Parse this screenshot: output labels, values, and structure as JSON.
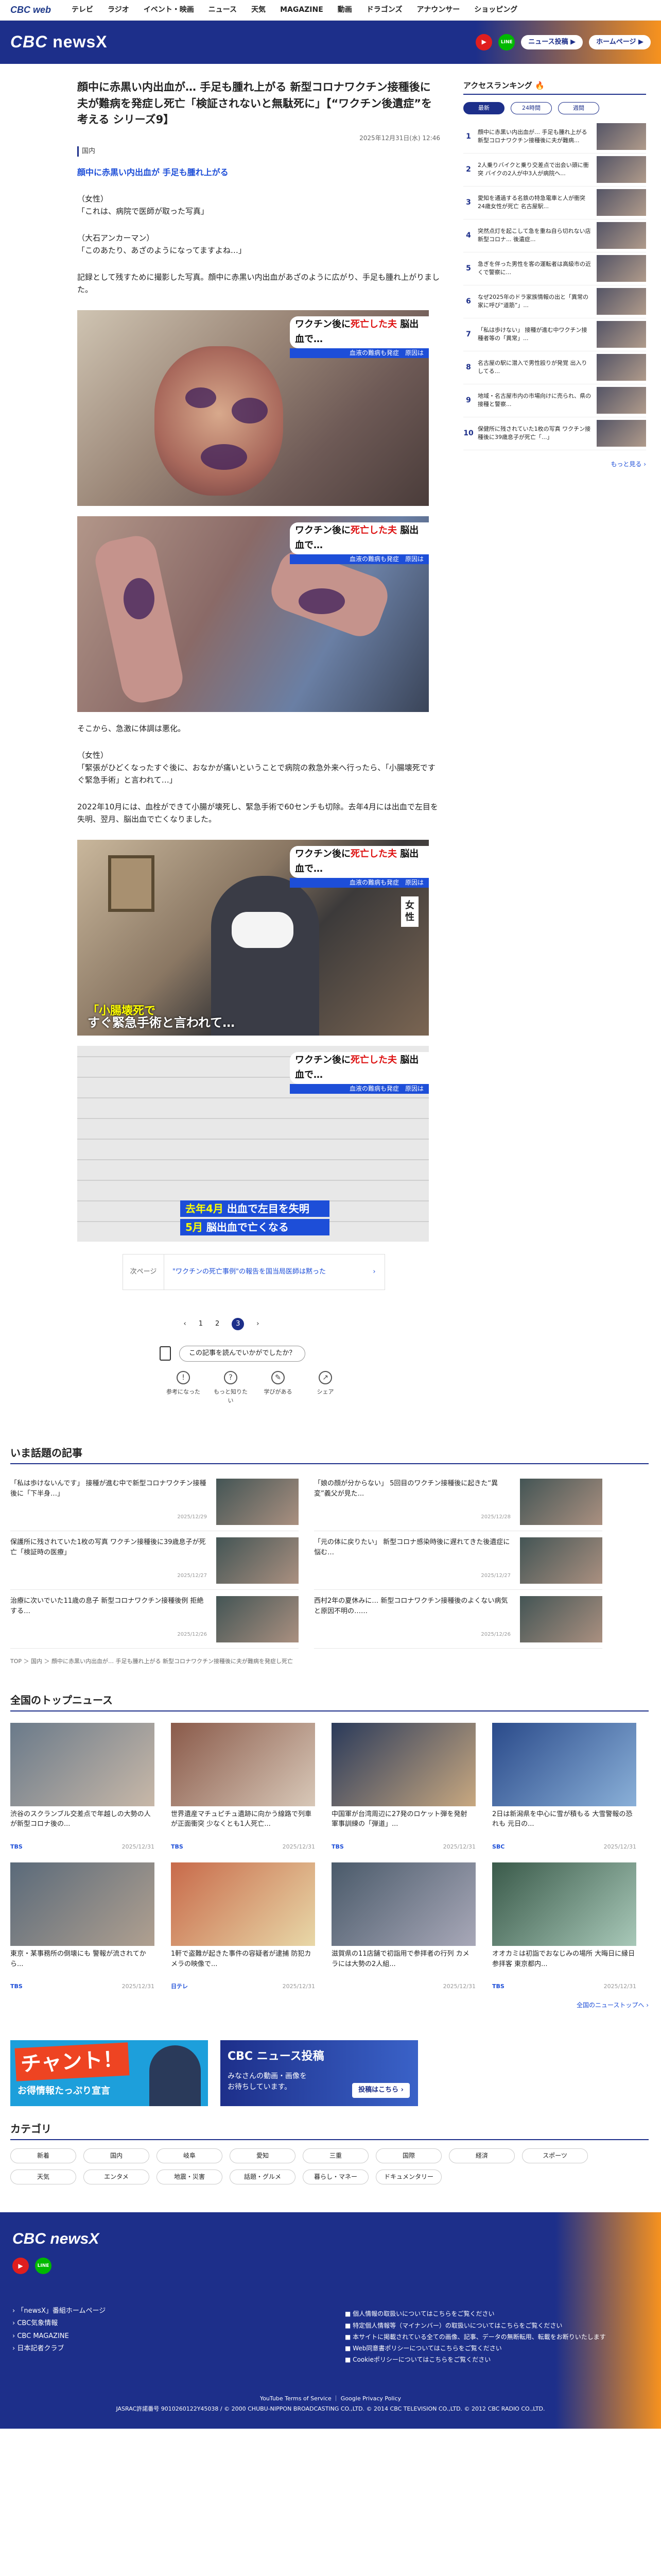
{
  "topnav": {
    "brand": "CBC web",
    "items": [
      "テレビ",
      "ラジオ",
      "イベント・映画",
      "ニュース",
      "天気",
      "MAGAZINE",
      "動画",
      "ドラゴンズ",
      "アナウンサー",
      "ショッピング"
    ]
  },
  "header": {
    "logo": "CBC",
    "logo_x": "newsX",
    "yt": "▶",
    "line": "LINE",
    "post": "ニュース投稿 ▶",
    "home": "ホームページ ▶"
  },
  "article": {
    "title": "顔中に赤黒い内出血が… 手足も腫れ上がる 新型コロナワクチン接種後に夫が難病を発症し死亡「検証されないと無駄死に」【“ワクチン後遺症”を考える シリーズ9】",
    "date": "2025年12月31日(水) 12:46",
    "category": "国内",
    "subhead": "顔中に赤黒い内出血が 手足も腫れ上がる",
    "p1": [
      "（女性）",
      "「これは、病院で医師が取った写真」"
    ],
    "p2": [
      "（大石アンカーマン）",
      "「このあたり、あざのようになってますよね…」"
    ],
    "p3": [
      "記録として残すために撮影した写真。顔中に赤黒い内出血があざのように広がり、手足も腫れ上がりました。"
    ],
    "tag1": "ワクチン後に",
    "tag1r": "死亡した夫",
    "tag1b": " 脳出血で…",
    "tag2": "血液の難病も発症　原因は",
    "p4": [
      "そこから、急激に体調は悪化。"
    ],
    "p5": [
      "（女性）",
      "「緊張がひどくなったすぐ後に、おなかが痛いということで病院の救急外来へ行ったら、「小腸壊死ですぐ緊急手術」と言われて…」"
    ],
    "p6": [
      "2022年10月には、血栓ができて小腸が壊死し、緊急手術で60センチも切除。去年4月には出血で左目を失明、翌月、脳出血で亡くなりました。"
    ],
    "cap_y": "「小腸壊死で",
    "cap_w": "すぐ緊急手術と言われて…",
    "side": "女性",
    "sub1a": "去年4月",
    "sub1b": " 出血で左目を失明",
    "sub2a": "5月",
    "sub2b": " 脳出血で亡くなる",
    "next_label": "次ページ",
    "next_text": "\"ワクチンの死亡事例\"の報告を国当局医師は黙った",
    "next_arrow": "›",
    "pages": [
      "‹",
      "1",
      "2",
      "3",
      "›"
    ],
    "react_q": "この記事を読んでいかがでしたか？",
    "reactions": [
      {
        "g": "!",
        "l": "参考になった"
      },
      {
        "g": "?",
        "l": "もっと知りたい"
      },
      {
        "g": "✎",
        "l": "学びがある"
      },
      {
        "g": "↗",
        "l": "シェア"
      }
    ]
  },
  "sidebar": {
    "title": "アクセスランキング",
    "title_icon": "🔥",
    "tabs": [
      "最新",
      "24時間",
      "週間"
    ],
    "items": [
      {
        "n": "1",
        "t": "顔中に赤黒い内出血が… 手足も腫れ上がる 新型コロナワクチン接種後に夫が難病..."
      },
      {
        "n": "2",
        "t": "2人乗りバイクと乗り交差点で出会い頭に衝突 バイクの2人が中3人が病院へ..."
      },
      {
        "n": "3",
        "t": "愛知を通過する名鉄の特急電車と人が衝突 24歳女性が死亡 名古屋駅..."
      },
      {
        "n": "4",
        "t": "突然点灯を起こして急を重ね自ら切れない店 新型コロナ... 後遺症..."
      },
      {
        "n": "5",
        "t": "急ぎを伴った男性を客の運転者は高級市の近くで警察に..."
      },
      {
        "n": "6",
        "t": "なぜ2025年のドラ家族情報の出と「異常の家に呼び“道筋”」..."
      },
      {
        "n": "7",
        "t": "「私は歩けない」 接種が進む中ワクチン接種者等の「異常」..."
      },
      {
        "n": "8",
        "t": "名古屋の駅に潜入で男性殴りが発覚 出入りしてる..."
      },
      {
        "n": "9",
        "t": "地域・名古屋市内の市場向けに売られ、県の接種と警察..."
      },
      {
        "n": "10",
        "t": "保健所に残されていた1枚の写真 ワクチン接種後に39歳息子が死亡「...」"
      }
    ],
    "more": "もっと見る ›"
  },
  "trending": {
    "title": "いま話題の記事",
    "items": [
      {
        "t": "「私は歩けないんです」 接種が進む中で新型コロナワクチン接種後に「下半身…」",
        "d": "2025/12/29"
      },
      {
        "t": "「娘の顔が分からない」 5回目のワクチン接種後に起きた“異変”義父が見た...",
        "d": "2025/12/28"
      },
      {
        "t": "保護所に残されていた1枚の写真 ワクチン接種後に39歳息子が死亡「検証時の医療」",
        "d": "2025/12/27"
      },
      {
        "t": "「元の体に戻りたい」 新型コロナ感染時後に遅れてきた後遺症に悩む…",
        "d": "2025/12/27"
      },
      {
        "t": "治療に次いでいた11歳の息子 新型コロナワクチン接種後例 拒絶する…",
        "d": "2025/12/26"
      },
      {
        "t": "西村2年の夏休みに… 新型コロナワクチン接種後のよくない病気と原因不明の……",
        "d": "2025/12/26"
      }
    ]
  },
  "crumb": "TOP ＞ 国内 ＞ 顔中に赤黒い内出血が… 手足も腫れ上がる 新型コロナワクチン接種後に夫が難病を発症し死亡",
  "national": {
    "title": "全国のトップニュース",
    "items": [
      {
        "t": "渋谷のスクランブル交差点で年越しの大勢の人が新型コロナ後の...",
        "s": "TBS",
        "d": "2025/12/31"
      },
      {
        "t": "世界遺産マチュピチュ遺跡に向かう線路で列車が正面衝突 少なくとも1人死亡...",
        "s": "TBS",
        "d": "2025/12/31"
      },
      {
        "t": "中国軍が台湾周辺に27発のロケット弾を発射 軍事訓練の「弾道」...",
        "s": "TBS",
        "d": "2025/12/31"
      },
      {
        "t": "2日は新潟県を中心に雪が積もる 大雪警報の恐れも 元日の...",
        "s": "SBC",
        "d": "2025/12/31"
      },
      {
        "t": "東京・某事務所の倒壊にも 警報が流されてから...",
        "s": "TBS",
        "d": "2025/12/31"
      },
      {
        "t": "1軒で盗難が起きた事件の容疑者が逮捕 防犯カメラの映像で...",
        "s": "日テレ",
        "d": "2025/12/31"
      },
      {
        "t": "滋賀県の11店舗で初詣用で参拝者の行列 カメラには大勢の2人組...",
        "s": "",
        "d": "2025/12/31"
      },
      {
        "t": "オオカミは初詣でおなじみの場所 大晦日に縁日参拝客 東京都内...",
        "s": "TBS",
        "d": "2025/12/31"
      }
    ],
    "more": "全国のニューストップへ ›"
  },
  "banners": {
    "b1": "チャント！",
    "b1s": "お得情報たっぷり宣言",
    "b2a": "CBC ニュース投稿",
    "b2b": "みなさんの動画・画像を\nお待ちしています。",
    "b2c": "投稿はこちら ›"
  },
  "categories": {
    "title": "カテゴリ",
    "items": [
      "新着",
      "国内",
      "岐阜",
      "愛知",
      "三重",
      "国際",
      "経済",
      "スポーツ",
      "天気",
      "エンタメ",
      "地震・災害",
      "話題・グルメ",
      "暮らし・マネー",
      "ドキュメンタリー"
    ]
  },
  "footer": {
    "logo": "CBC newsX",
    "links": [
      "「newsX」番組ホームページ",
      "CBC気象情報",
      "CBC MAGAZINE",
      "日本記者クラブ"
    ],
    "links2": [
      "個人情報の取扱いについてはこちらをご覧ください",
      "特定個人情報等（マイナンバー）の取扱いについてはこちらをご覧ください",
      "本サイトに掲載されている全ての画像、記事、データの無断転用、転載をお断りいたします",
      "Web同意書ポリシーについてはこちらをご覧ください",
      "Cookieポリシーについてはこちらをご覧ください"
    ],
    "copy1": "YouTube Terms of Service ｜ Google Privacy Policy",
    "copy2": "JASRAC許諾番号 9010260122Y45038 / © 2000 CHUBU-NIPPON BROADCASTING CO.,LTD. © 2014 CBC TELEVISION CO.,LTD. © 2012 CBC RADIO CO.,LTD."
  }
}
